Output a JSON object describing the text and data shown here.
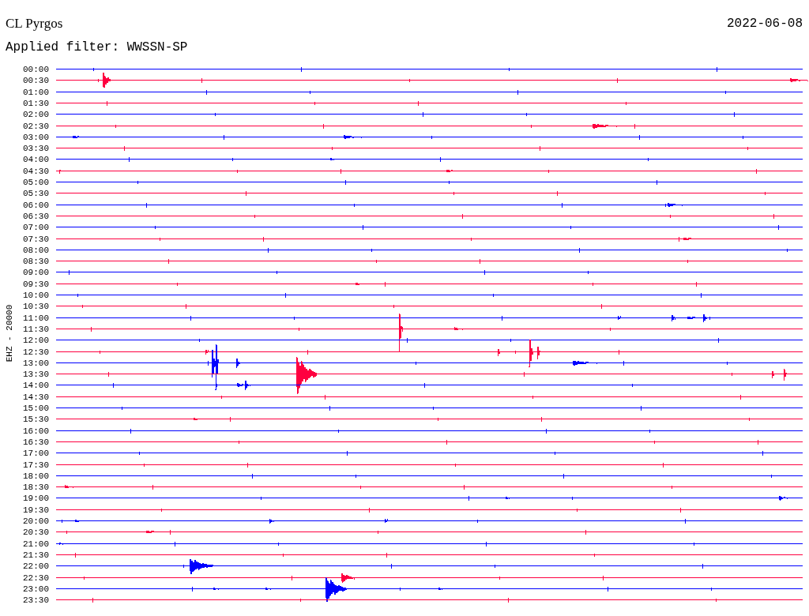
{
  "station": "CL Pyrgos",
  "date": "2022-06-08",
  "filter_label": "Applied filter: WWSSN-SP",
  "axis_label": "EHZ - 20000",
  "rows": [
    {
      "time": "00:00",
      "color": "#0000ff"
    },
    {
      "time": "00:30",
      "color": "#ff0040"
    },
    {
      "time": "01:00",
      "color": "#0000ff"
    },
    {
      "time": "01:30",
      "color": "#ff0040"
    },
    {
      "time": "02:00",
      "color": "#0000ff"
    },
    {
      "time": "02:30",
      "color": "#ff0040"
    },
    {
      "time": "03:00",
      "color": "#0000ff"
    },
    {
      "time": "03:30",
      "color": "#ff0040"
    },
    {
      "time": "04:00",
      "color": "#0000ff"
    },
    {
      "time": "04:30",
      "color": "#ff0040"
    },
    {
      "time": "05:00",
      "color": "#0000ff"
    },
    {
      "time": "05:30",
      "color": "#ff0040"
    },
    {
      "time": "06:00",
      "color": "#0000ff"
    },
    {
      "time": "06:30",
      "color": "#ff0040"
    },
    {
      "time": "07:00",
      "color": "#0000ff"
    },
    {
      "time": "07:30",
      "color": "#ff0040"
    },
    {
      "time": "08:00",
      "color": "#0000ff"
    },
    {
      "time": "08:30",
      "color": "#ff0040"
    },
    {
      "time": "09:00",
      "color": "#0000ff"
    },
    {
      "time": "09:30",
      "color": "#ff0040"
    },
    {
      "time": "10:00",
      "color": "#0000ff"
    },
    {
      "time": "10:30",
      "color": "#ff0040"
    },
    {
      "time": "11:00",
      "color": "#0000ff"
    },
    {
      "time": "11:30",
      "color": "#ff0040"
    },
    {
      "time": "12:00",
      "color": "#0000ff"
    },
    {
      "time": "12:30",
      "color": "#ff0040"
    },
    {
      "time": "13:00",
      "color": "#0000ff"
    },
    {
      "time": "13:30",
      "color": "#ff0040"
    },
    {
      "time": "14:00",
      "color": "#0000ff"
    },
    {
      "time": "14:30",
      "color": "#ff0040"
    },
    {
      "time": "15:00",
      "color": "#0000ff"
    },
    {
      "time": "15:30",
      "color": "#ff0040"
    },
    {
      "time": "16:00",
      "color": "#0000ff"
    },
    {
      "time": "16:30",
      "color": "#ff0040"
    },
    {
      "time": "17:00",
      "color": "#0000ff"
    },
    {
      "time": "17:30",
      "color": "#ff0040"
    },
    {
      "time": "18:00",
      "color": "#0000ff"
    },
    {
      "time": "18:30",
      "color": "#ff0040"
    },
    {
      "time": "19:00",
      "color": "#0000ff"
    },
    {
      "time": "19:30",
      "color": "#ff0040"
    },
    {
      "time": "20:00",
      "color": "#0000ff"
    },
    {
      "time": "20:30",
      "color": "#ff0040"
    },
    {
      "time": "21:00",
      "color": "#0000ff"
    },
    {
      "time": "21:30",
      "color": "#ff0040"
    },
    {
      "time": "22:00",
      "color": "#0000ff"
    },
    {
      "time": "22:30",
      "color": "#ff0040"
    },
    {
      "time": "23:00",
      "color": "#0000ff"
    },
    {
      "time": "23:30",
      "color": "#ff0040"
    }
  ]
}
